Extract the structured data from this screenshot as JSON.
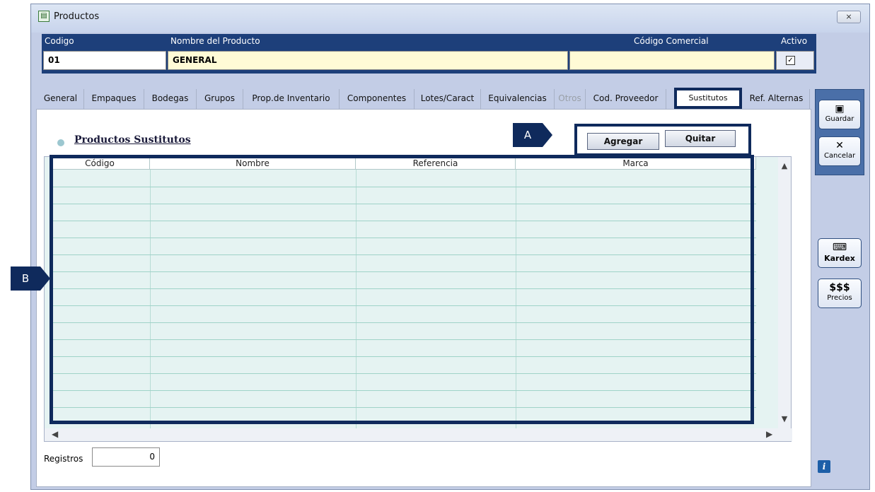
{
  "window": {
    "title": "Productos",
    "close_label": "⨯"
  },
  "header": {
    "codigo_label": "Codigo",
    "nombre_label": "Nombre del Producto",
    "comercial_label": "Código Comercial",
    "activo_label": "Activo",
    "codigo_value": "01",
    "nombre_value": "GENERAL",
    "comercial_value": "",
    "activo_checked": true
  },
  "tabs": [
    {
      "label": "General"
    },
    {
      "label": "Empaques"
    },
    {
      "label": "Bodegas"
    },
    {
      "label": "Grupos"
    },
    {
      "label": "Prop.de Inventario"
    },
    {
      "label": "Componentes"
    },
    {
      "label": "Lotes/Caract"
    },
    {
      "label": "Equivalencias"
    },
    {
      "label": "Otros"
    },
    {
      "label": "Cod. Proveedor"
    },
    {
      "label": "Sustitutos"
    },
    {
      "label": "Ref. Alternas"
    }
  ],
  "section": {
    "title": "Productos Sustitutos"
  },
  "buttons": {
    "agregar": "Agregar",
    "quitar": "Quitar"
  },
  "callouts": {
    "a": "A",
    "b": "B"
  },
  "grid": {
    "columns": [
      "Código",
      "Nombre",
      "Referencia",
      "Marca"
    ],
    "rows": []
  },
  "footer": {
    "registros_label": "Registros",
    "registros_value": "0"
  },
  "side": {
    "guardar": "Guardar",
    "cancelar": "Cancelar",
    "kardex": "Kardex",
    "precios_symbol": "$$$",
    "precios": "Precios"
  },
  "icons": {
    "app": "product-window-icon",
    "save": "floppy-disk-icon",
    "cancel": "x-cancel-icon",
    "kardex": "keyboard-icon",
    "info": "info-icon"
  }
}
